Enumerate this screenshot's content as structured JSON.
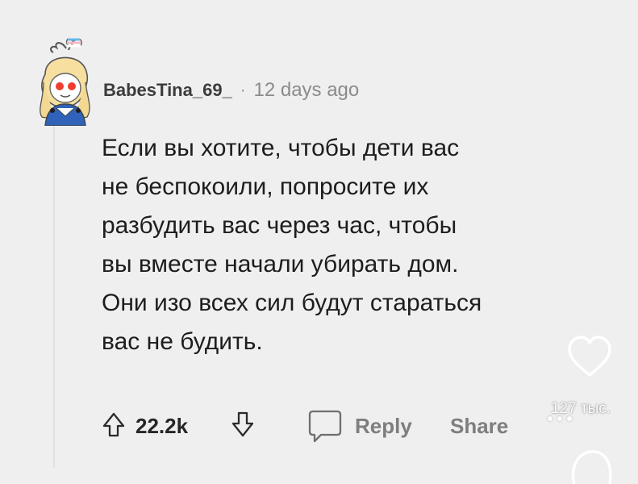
{
  "comment": {
    "username": "BabesTina_69_",
    "separator": "·",
    "time": "12 days ago",
    "body_lines": [
      "Если вы хотите, чтобы дети вас",
      "не беспокоили, попросите их",
      "разбудить вас через час, чтобы",
      "вы вместе начали убирать дом.",
      "Они изо всех сил будут стараться",
      "вас не будить."
    ],
    "score": "22.2k",
    "reply_label": "Reply",
    "share_label": "Share"
  },
  "overlay": {
    "like_count": "127 тыс."
  },
  "icons": {
    "avatar": "avatar-icon",
    "upvote": "upvote-arrow-icon",
    "downvote": "downvote-arrow-icon",
    "reply": "speech-bubble-icon",
    "like": "heart-icon",
    "more": "more-dots-icon",
    "comments": "comment-bubble-icon"
  },
  "colors": {
    "background": "#efefef",
    "text": "#1d1d1d",
    "muted": "#8b8b8b",
    "overlay_icon": "#ffffff"
  }
}
